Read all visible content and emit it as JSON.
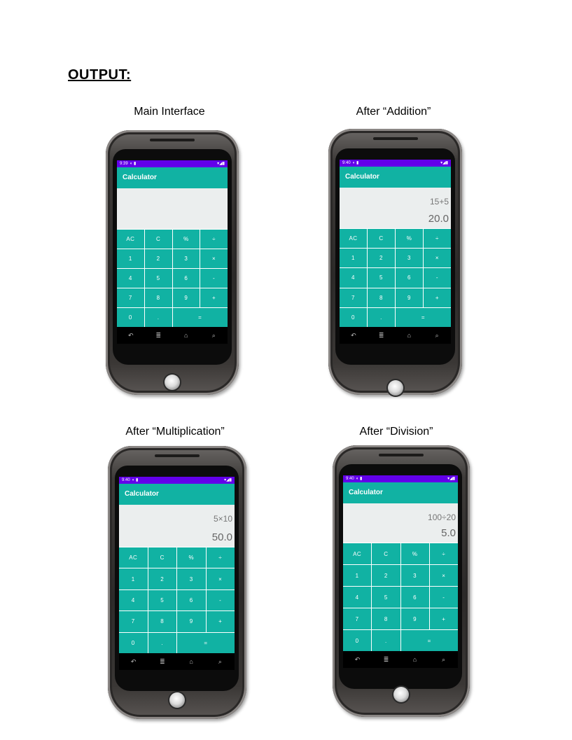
{
  "heading": "OUTPUT:",
  "panels": [
    {
      "caption": "Main Interface",
      "status_time": "9:39",
      "status_left_icons": "◐ ▮",
      "status_right_icons": "▾◢▮",
      "app_title": "Calculator",
      "expression": "",
      "result": "",
      "keys": [
        "AC",
        "C",
        "%",
        "÷",
        "1",
        "2",
        "3",
        "×",
        "4",
        "5",
        "6",
        "-",
        "7",
        "8",
        "9",
        "+",
        "0",
        ".",
        "="
      ],
      "nav": [
        "↶",
        "≣",
        "⌂",
        "⌕"
      ]
    },
    {
      "caption": "After “Addition”",
      "status_time": "9:40",
      "status_left_icons": "◐ ▮",
      "status_right_icons": "▾◢▮",
      "app_title": "Calculator",
      "expression": "15+5",
      "result": "20.0",
      "keys": [
        "AC",
        "C",
        "%",
        "÷",
        "1",
        "2",
        "3",
        "×",
        "4",
        "5",
        "6",
        "-",
        "7",
        "8",
        "9",
        "+",
        "0",
        ".",
        "="
      ],
      "nav": [
        "↶",
        "≣",
        "⌂",
        "⌕"
      ]
    },
    {
      "caption": "After “Multiplication”",
      "status_time": "9:40",
      "status_left_icons": "◐ ▮",
      "status_right_icons": "▾◢▮",
      "app_title": "Calculator",
      "expression": "5×10",
      "result": "50.0",
      "keys": [
        "AC",
        "C",
        "%",
        "÷",
        "1",
        "2",
        "3",
        "×",
        "4",
        "5",
        "6",
        "-",
        "7",
        "8",
        "9",
        "+",
        "0",
        ".",
        "="
      ],
      "nav": [
        "↶",
        "≣",
        "⌂",
        "⌕"
      ]
    },
    {
      "caption": "After “Division”",
      "status_time": "9:40",
      "status_left_icons": "◐ ▮",
      "status_right_icons": "▾◢▮",
      "app_title": "Calculator",
      "expression": "100÷20",
      "result": "5.0",
      "keys": [
        "AC",
        "C",
        "%",
        "÷",
        "1",
        "2",
        "3",
        "×",
        "4",
        "5",
        "6",
        "-",
        "7",
        "8",
        "9",
        "+",
        "0",
        ".",
        "="
      ],
      "nav": [
        "↶",
        "≣",
        "⌂",
        "⌕"
      ]
    }
  ],
  "colors": {
    "status_bar": "#6200ea",
    "accent": "#11b2a3",
    "display_bg": "#ebeeee"
  }
}
